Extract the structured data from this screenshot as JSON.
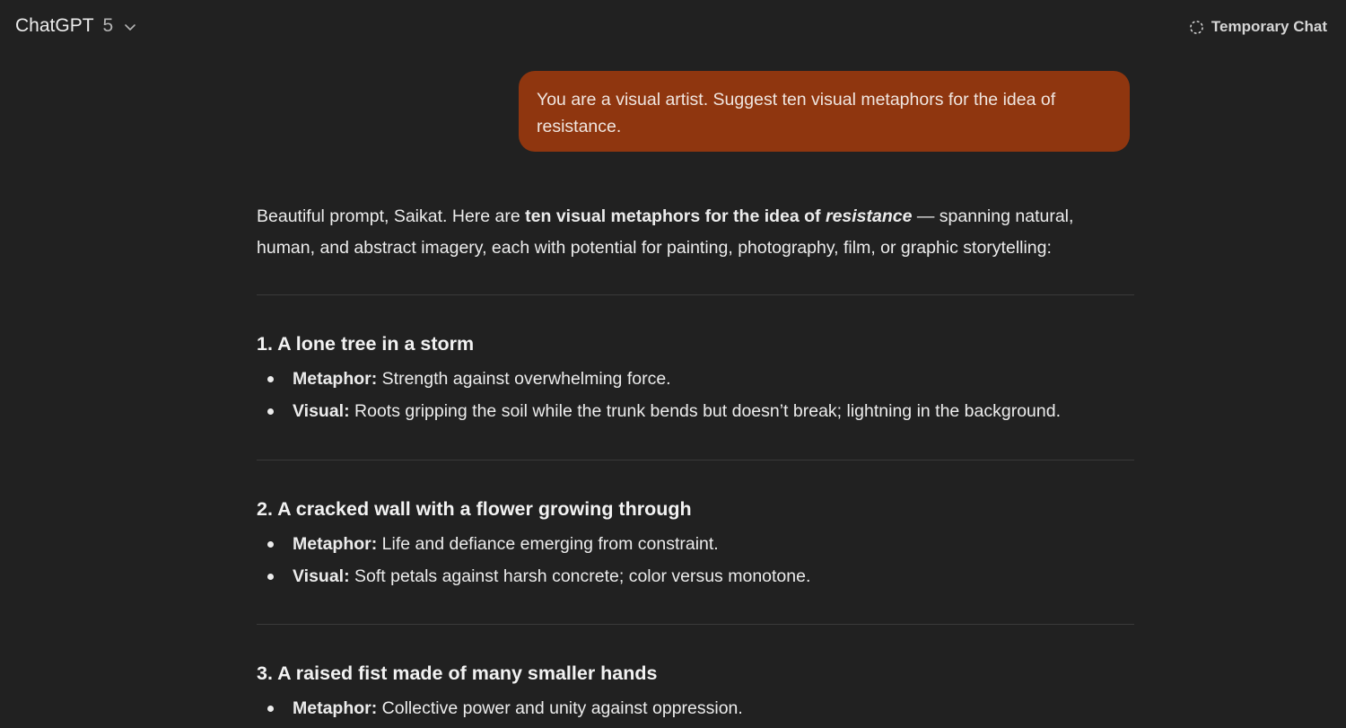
{
  "header": {
    "model_name": "ChatGPT",
    "model_version": "5",
    "chevron_icon": "chevron-down-icon",
    "temporary_chat_label": "Temporary Chat",
    "temporary_chat_icon": "dashed-circle-icon"
  },
  "user_message": {
    "text": "You are a visual artist. Suggest ten visual metaphors for the idea of resistance.",
    "bubble_color": "#8f360f"
  },
  "assistant": {
    "intro": {
      "lead": "Beautiful prompt, Saikat. Here are ",
      "bold": "ten visual metaphors for the idea of ",
      "bold_italic": "resistance",
      "rest": " — spanning natural, human, and abstract imagery, each with potential for painting, photography, film, or graphic storytelling:"
    },
    "items": [
      {
        "title": "1. A lone tree in a storm",
        "bullets": [
          {
            "label": "Metaphor:",
            "text": " Strength against overwhelming force."
          },
          {
            "label": "Visual:",
            "text": " Roots gripping the soil while the trunk bends but doesn’t break; lightning in the background."
          }
        ]
      },
      {
        "title": "2. A cracked wall with a flower growing through",
        "bullets": [
          {
            "label": "Metaphor:",
            "text": " Life and defiance emerging from constraint."
          },
          {
            "label": "Visual:",
            "text": " Soft petals against harsh concrete; color versus monotone."
          }
        ]
      },
      {
        "title": "3. A raised fist made of many smaller hands",
        "bullets": [
          {
            "label": "Metaphor:",
            "text": " Collective power and unity against oppression."
          }
        ]
      }
    ]
  },
  "colors": {
    "background": "#212121",
    "text": "#ececec",
    "divider": "#3a3a3a"
  }
}
